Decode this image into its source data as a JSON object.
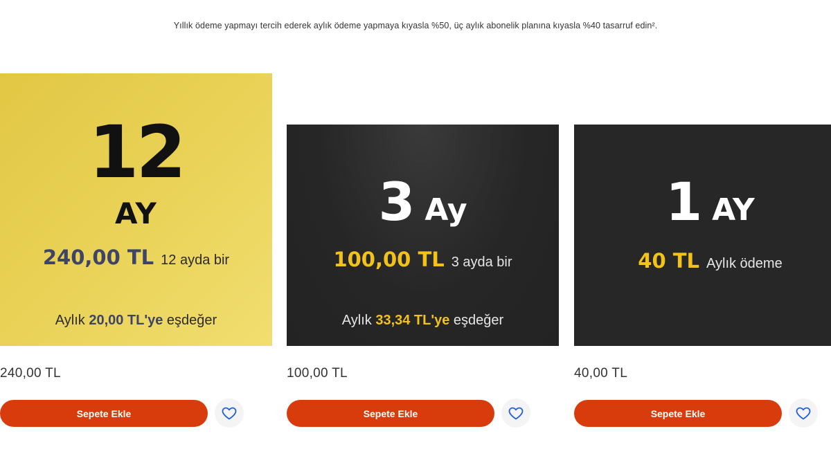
{
  "note": "Yıllık ödeme yapmayı tercih ederek aylık ödeme yapmaya kıyasla %50, üç aylık abonelik planına kıyasla %40 tasarruf edin².",
  "colors": {
    "accent_button": "#d93c0c",
    "gold_banner": "#e8cf52",
    "dark_banner": "#262626",
    "price_yellow": "#f2c21b",
    "price_navy": "#3d4466",
    "heart_icon": "#1f5ed6"
  },
  "plans": [
    {
      "number": "12",
      "unit": "AY",
      "price": "240,00 TL",
      "period": "12 ayda bir",
      "equiv_prefix": "Aylık ",
      "equiv_value": "20,00 TL'ye",
      "equiv_suffix": " eşdeğer",
      "list_price": "240,00 TL",
      "button_label": "Sepete Ekle",
      "favorite_icon": "heart-outline-icon"
    },
    {
      "number": "3",
      "unit": "Ay",
      "price": "100,00 TL",
      "period": "3 ayda bir",
      "equiv_prefix": "Aylık ",
      "equiv_value": "33,34 TL'ye",
      "equiv_suffix": " eşdeğer",
      "list_price": "100,00 TL",
      "button_label": "Sepete Ekle",
      "favorite_icon": "heart-outline-icon"
    },
    {
      "number": "1",
      "unit": "AY",
      "price": "40 TL",
      "period": "Aylık ödeme",
      "list_price": "40,00 TL",
      "button_label": "Sepete Ekle",
      "favorite_icon": "heart-outline-icon"
    }
  ]
}
